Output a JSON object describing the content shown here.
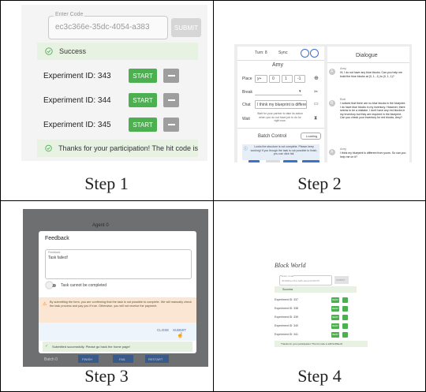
{
  "captions": [
    "Step 1",
    "Step 2",
    "Step 3",
    "Step 4"
  ],
  "colors": {
    "success_green": "#4caf50",
    "disabled_gray": "#9e9e9e",
    "alert_bg": "#e7f2e2",
    "link_blue": "#3f6fc8"
  },
  "step1": {
    "code_legend": "Enter Code",
    "code_value": "ec3c366e-35dc-4054-a383",
    "submit_label": "SUBMIT",
    "success_text": "Success",
    "experiments": [
      {
        "label": "Experiment ID: 343",
        "start": "START"
      },
      {
        "label": "Experiment ID: 344",
        "start": "START"
      },
      {
        "label": "Experiment ID: 345",
        "start": "START"
      }
    ],
    "thanks_text": "Thanks for your participation! The hit code is"
  },
  "step2": {
    "turn_label": "Turn: 8",
    "sync_label": "Sync:",
    "player_name": "Amy",
    "place_label": "Place",
    "place_values": [
      "y+",
      "0",
      "1",
      "-1"
    ],
    "break_label": "Break",
    "chat_label": "Chat",
    "chat_value": "I think my blueprint is differe",
    "wait_label": "Wait",
    "wait_hint": "Wait for your partner to take its action when you do not have job to do for right now.",
    "batch_title": "Batch Control",
    "loading_label": "Loading",
    "info_text": "Looks the structure is not complete. Please keep working! If you though the task is not possible to finish, you can click fail.",
    "dialogue_title": "Dialogue",
    "messages": [
      {
        "avatar": "A",
        "name": "Amy",
        "text": "Hi, I do not have any blue blocks. Can you help me build the blue blocks at (0, 1, -1) to (0, 1, 1)?"
      },
      {
        "avatar": "B",
        "name": "Bob",
        "text": "I noticed that there are no blue blocks in the blueprint. I do have blue blocks in my inventory. However, there seems to be a mistake. I don't have any red blocks in my inventory but they are required in the blueprint. Can you check your inventory for red blocks, Amy?"
      },
      {
        "avatar": "A",
        "name": "Amy",
        "text": "I think my blueprint is different from yours. So can you help me on it?"
      }
    ]
  },
  "step3": {
    "agent_label": "Agent 0",
    "modal_title": "Feedback",
    "feedback_legend": "Feedback",
    "feedback_value": "Task failed!",
    "toggle_label": "Task cannot be completed",
    "warning_text": "By submitting the form, you are confirming that the task is not possible to complete. We will manually check the task process and pay you if true. Otherwise, you will not receive the payment.",
    "close_label": "CLOSE",
    "submit_label": "SUBMIT",
    "success_text": "Submitted successfully. Please go back the home page!",
    "batch_label": "Batch 0",
    "bottom_buttons": [
      "FINISH",
      "FAIL",
      "RESTART"
    ]
  },
  "step4": {
    "title": "Block World",
    "code_legend": "Enter Code",
    "code_value": "4b4f9d6a-cf13-4e8b-a4ea-db34b7f6",
    "submit_label": "SUBMIT",
    "success_text": "Success",
    "experiments": [
      {
        "label": "Experiment ID: 337",
        "start": "READY"
      },
      {
        "label": "Experiment ID: 338",
        "start": "READY"
      },
      {
        "label": "Experiment ID: 339",
        "start": "READY"
      },
      {
        "label": "Experiment ID: 340",
        "start": "READY"
      },
      {
        "label": "Experiment ID: 341",
        "start": "READY"
      }
    ],
    "thanks_text": "Thanks for your participation! The hit code is a3f7a1fb9ec6"
  }
}
